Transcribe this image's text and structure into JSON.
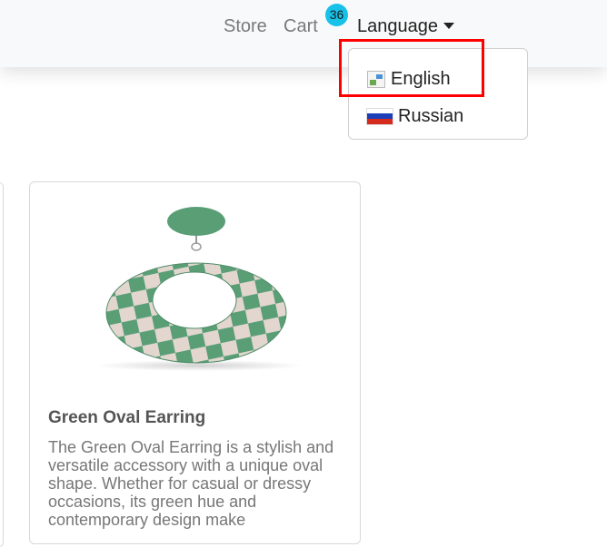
{
  "nav": {
    "store_label": "Store",
    "cart_label": "Cart",
    "cart_count": "36",
    "language_label": "Language"
  },
  "language_menu": {
    "items": [
      {
        "label": "English",
        "icon": "broken-image-icon"
      },
      {
        "label": "Russian",
        "icon": "russia-flag-icon"
      }
    ]
  },
  "product": {
    "title": "Green Oval Earring",
    "description": "The Green Oval Earring is a stylish and versatile accessory with a unique oval shape. Whether for casual or dressy occasions, its green hue and contemporary design make"
  },
  "colors": {
    "accent_badge": "#17c1e8",
    "highlight": "#ff0000",
    "earring_green": "#5a9e76",
    "earring_beige": "#e2d6cf"
  }
}
